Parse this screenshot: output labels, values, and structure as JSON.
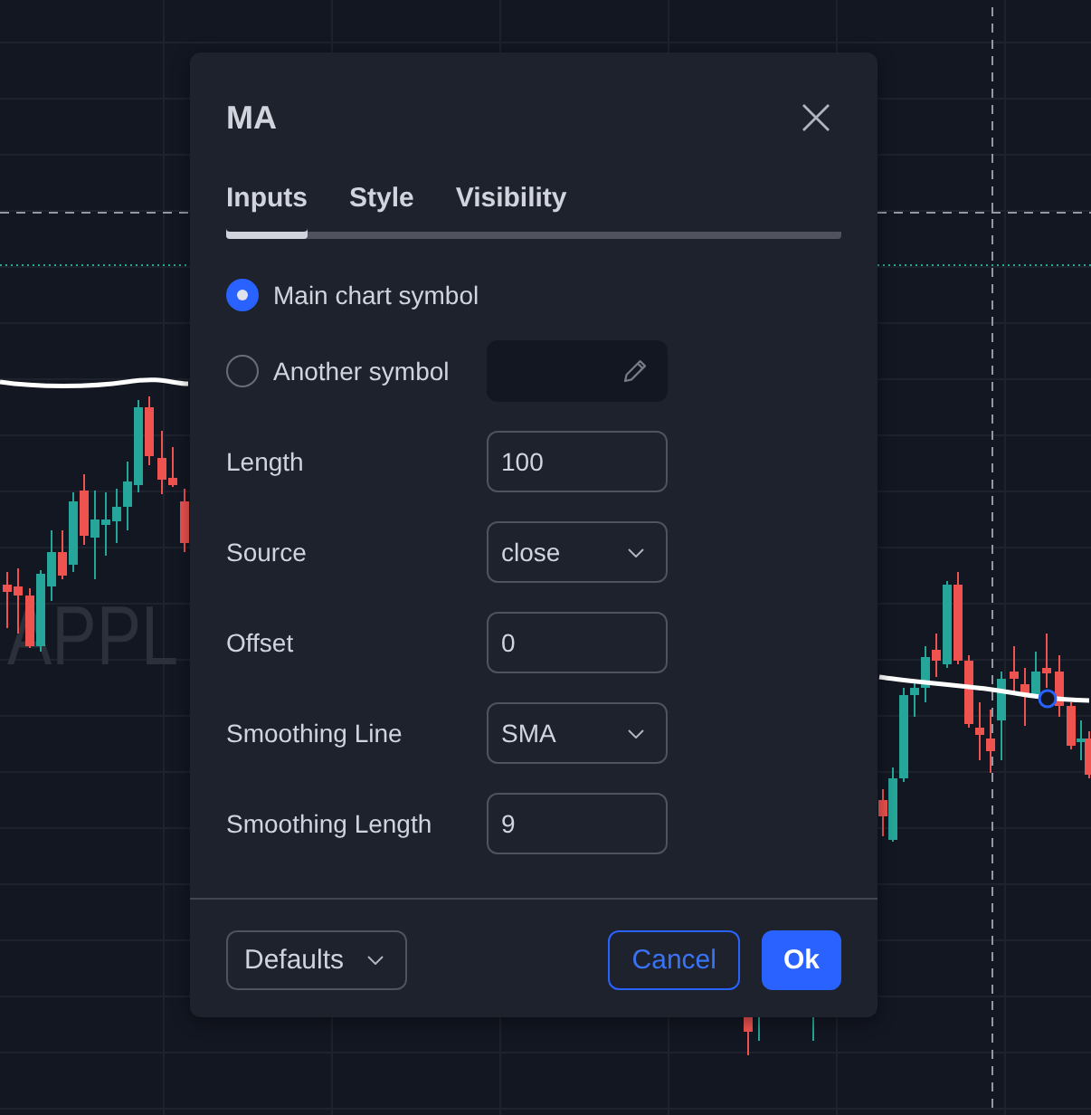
{
  "chart": {
    "symbol_watermark": "APPL"
  },
  "dialog": {
    "title": "MA",
    "tabs": [
      {
        "label": "Inputs",
        "selected": true
      },
      {
        "label": "Style",
        "selected": false
      },
      {
        "label": "Visibility",
        "selected": false
      }
    ],
    "inputs": [
      {
        "kind": "radio",
        "label": "Main chart symbol",
        "selected": true
      },
      {
        "kind": "radio",
        "label": "Another symbol",
        "selected": false,
        "symbol_field": {
          "disabled": true
        }
      },
      {
        "kind": "number",
        "label": "Length",
        "value": "100"
      },
      {
        "kind": "select",
        "label": "Source",
        "value": "close"
      },
      {
        "kind": "number",
        "label": "Offset",
        "value": "0"
      },
      {
        "kind": "select",
        "label": "Smoothing Line",
        "value": "SMA"
      },
      {
        "kind": "number",
        "label": "Smoothing Length",
        "value": "9"
      }
    ],
    "buttons": [
      {
        "kind": "menu",
        "label": "Defaults"
      },
      {
        "kind": "secondary",
        "label": "Cancel"
      },
      {
        "kind": "primary",
        "label": "Ok"
      }
    ]
  }
}
